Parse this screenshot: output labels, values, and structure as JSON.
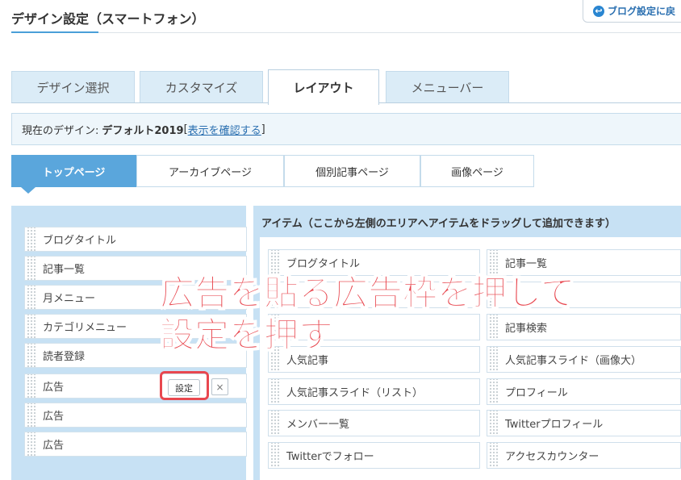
{
  "header": {
    "title": "デザイン設定（スマートフォン）",
    "back_button_label": "ブログ設定に戻"
  },
  "main_tabs": [
    {
      "label": "デザイン選択",
      "active": false
    },
    {
      "label": "カスタマイズ",
      "active": false
    },
    {
      "label": "レイアウト",
      "active": true
    },
    {
      "label": "メニューバー",
      "active": false
    }
  ],
  "current_design": {
    "prefix": "現在のデザイン: ",
    "name": "デフォルト2019",
    "link_open": "[",
    "link_label": "表示を確認する",
    "link_close": "]"
  },
  "page_tabs": [
    {
      "label": "トップページ",
      "active": true
    },
    {
      "label": "アーカイブページ",
      "active": false
    },
    {
      "label": "個別記事ページ",
      "active": false
    },
    {
      "label": "画像ページ",
      "active": false
    }
  ],
  "layout_items": [
    "ブログタイトル",
    "記事一覧",
    "月メニュー",
    "カテゴリメニュー",
    "読者登録",
    "広告",
    "広告",
    "広告"
  ],
  "layout_item_actions": {
    "settings_label": "設定",
    "close_label": "×"
  },
  "items_panel": {
    "heading": "アイテム（ここから左側のエリアへアイテムをドラッグして追加できます）",
    "items": [
      "ブログタイトル",
      "記事一覧",
      "",
      "",
      "",
      "記事検索",
      "人気記事",
      "人気記事スライド（画像大）",
      "人気記事スライド（リスト）",
      "プロフィール",
      "メンバー一覧",
      "Twitterプロフィール",
      "Twitterでフォロー",
      "アクセスカウンター"
    ]
  },
  "annotation": {
    "line1": "広告を貼る広告枠を押して",
    "line2": "設定を押す"
  },
  "colors": {
    "accent": "#5aa6dc",
    "panel": "#c7e1f4",
    "annotation": "#e8474f",
    "link": "#2a6fb0"
  }
}
